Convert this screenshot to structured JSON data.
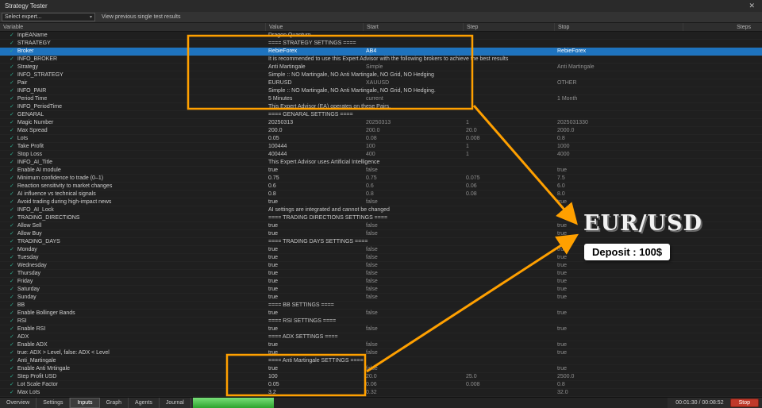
{
  "window": {
    "title": "Strategy Tester",
    "close_icon": "✕"
  },
  "icons": {
    "check": "✓",
    "chevron_down": "▾"
  },
  "toolbar": {
    "expert_select": "Select expert...",
    "hint": "View previous single test results"
  },
  "table": {
    "columns": [
      "Variable",
      "Value",
      "Start",
      "Step",
      "Stop",
      "Steps"
    ],
    "rows": [
      {
        "name": "InpEAName",
        "value": "Dragon Quantum",
        "start": "",
        "step": "",
        "stop": "",
        "steps": ""
      },
      {
        "name": "STRAATEGY",
        "value": "==== STRATEGY SETTINGS ====",
        "start": "",
        "step": "",
        "stop": "",
        "steps": ""
      },
      {
        "name": "Broker",
        "value": "RebieForex",
        "start": "AB4",
        "step": "",
        "stop": "RebieForex",
        "steps": "",
        "selected": true
      },
      {
        "name": "INFO_BROKER",
        "value": "It is recommended to use this Expert Advisor with the following brokers to achieve the best results",
        "start": "",
        "step": "",
        "stop": "",
        "steps": ""
      },
      {
        "name": "Strategy",
        "value": "Anti Martingale",
        "start": "Simple",
        "step": "",
        "stop": "Anti Martingale",
        "steps": ""
      },
      {
        "name": "INFO_STRATEGY",
        "value": "Simple :: NO Martingale, NO Anti Martingale, NO Grid, NO Hedging",
        "start": "",
        "step": "",
        "stop": "",
        "steps": ""
      },
      {
        "name": "Pair",
        "value": "EURUSD",
        "start": "XAUUSD",
        "step": "",
        "stop": "OTHER",
        "steps": ""
      },
      {
        "name": "INFO_PAIR",
        "value": "Simple :: NO Martingale, NO Anti Martingale, NO Grid, NO Hedging.",
        "start": "",
        "step": "",
        "stop": "",
        "steps": ""
      },
      {
        "name": "Period Time",
        "value": "5 Minutes",
        "start": "current",
        "step": "",
        "stop": "1 Month",
        "steps": ""
      },
      {
        "name": "INFO_PeriodTime",
        "value": "This Expert Advisor (EA) operates on these Pairs.",
        "start": "",
        "step": "",
        "stop": "",
        "steps": ""
      },
      {
        "name": "GENARAL",
        "value": "==== GENARAL SETTINGS ====",
        "start": "",
        "step": "",
        "stop": "",
        "steps": ""
      },
      {
        "name": "Magic Number",
        "value": "20250313",
        "start": "20250313",
        "step": "1",
        "stop": "2025031330",
        "steps": ""
      },
      {
        "name": "Max Spread",
        "value": "200.0",
        "start": "200.0",
        "step": "20.0",
        "stop": "2000.0",
        "steps": ""
      },
      {
        "name": "Lots",
        "value": "0.05",
        "start": "0.08",
        "step": "0.008",
        "stop": "0.8",
        "steps": ""
      },
      {
        "name": "Take Profit",
        "value": "100444",
        "start": "100",
        "step": "1",
        "stop": "1000",
        "steps": ""
      },
      {
        "name": "Stop Loss",
        "value": "400444",
        "start": "400",
        "step": "1",
        "stop": "4000",
        "steps": ""
      },
      {
        "name": "INFO_AI_Title",
        "value": "This Expert Advisor uses Artificial Intelligence",
        "start": "",
        "step": "",
        "stop": "",
        "steps": ""
      },
      {
        "name": "Enable AI module",
        "value": "true",
        "start": "false",
        "step": "",
        "stop": "true",
        "steps": ""
      },
      {
        "name": "Minimum confidence to trade (0–1)",
        "value": "0.75",
        "start": "0.75",
        "step": "0.075",
        "stop": "7.5",
        "steps": ""
      },
      {
        "name": "Reaction sensitivity to market changes",
        "value": "0.6",
        "start": "0.6",
        "step": "0.06",
        "stop": "6.0",
        "steps": ""
      },
      {
        "name": "AI influence vs technical signals",
        "value": "0.8",
        "start": "0.8",
        "step": "0.08",
        "stop": "8.0",
        "steps": ""
      },
      {
        "name": "Avoid trading during high-impact news",
        "value": "true",
        "start": "false",
        "step": "",
        "stop": "true",
        "steps": ""
      },
      {
        "name": "INFO_AI_Lock",
        "value": "AI settings are integrated and cannot be changed",
        "start": "",
        "step": "",
        "stop": "",
        "steps": ""
      },
      {
        "name": "TRADING_DIRECTIONS",
        "value": "==== TRADING DIRECTIONS SETTINGS ====",
        "start": "",
        "step": "",
        "stop": "",
        "steps": ""
      },
      {
        "name": "Allow Sell",
        "value": "true",
        "start": "false",
        "step": "",
        "stop": "true",
        "steps": ""
      },
      {
        "name": "Allow Buy",
        "value": "true",
        "start": "false",
        "step": "",
        "stop": "true",
        "steps": ""
      },
      {
        "name": "TRADING_DAYS",
        "value": "==== TRADING DAYS SETTINGS ====",
        "start": "",
        "step": "",
        "stop": "",
        "steps": ""
      },
      {
        "name": "Monday",
        "value": "true",
        "start": "false",
        "step": "",
        "stop": "true",
        "steps": ""
      },
      {
        "name": "Tuesday",
        "value": "true",
        "start": "false",
        "step": "",
        "stop": "true",
        "steps": ""
      },
      {
        "name": "Wednesday",
        "value": "true",
        "start": "false",
        "step": "",
        "stop": "true",
        "steps": ""
      },
      {
        "name": "Thursday",
        "value": "true",
        "start": "false",
        "step": "",
        "stop": "true",
        "steps": ""
      },
      {
        "name": "Friday",
        "value": "true",
        "start": "false",
        "step": "",
        "stop": "true",
        "steps": ""
      },
      {
        "name": "Saturday",
        "value": "true",
        "start": "false",
        "step": "",
        "stop": "true",
        "steps": ""
      },
      {
        "name": "Sunday",
        "value": "true",
        "start": "false",
        "step": "",
        "stop": "true",
        "steps": ""
      },
      {
        "name": "BB",
        "value": "==== BB SETTINGS ====",
        "start": "",
        "step": "",
        "stop": "",
        "steps": ""
      },
      {
        "name": "Enable Bollinger Bands",
        "value": "true",
        "start": "false",
        "step": "",
        "stop": "true",
        "steps": ""
      },
      {
        "name": "RSI",
        "value": "==== RSI SETTINGS ====",
        "start": "",
        "step": "",
        "stop": "",
        "steps": ""
      },
      {
        "name": "Enable RSI",
        "value": "true",
        "start": "false",
        "step": "",
        "stop": "true",
        "steps": ""
      },
      {
        "name": "ADX",
        "value": "==== ADX SETTINGS ====",
        "start": "",
        "step": "",
        "stop": "",
        "steps": ""
      },
      {
        "name": "Enable ADX",
        "value": "true",
        "start": "false",
        "step": "",
        "stop": "true",
        "steps": ""
      },
      {
        "name": "true: ADX > Level, false: ADX < Level",
        "value": "true",
        "start": "false",
        "step": "",
        "stop": "true",
        "steps": ""
      },
      {
        "name": "Anti_Martingale",
        "value": "==== Anti Martingale SETTINGS ====",
        "start": "",
        "step": "",
        "stop": "",
        "steps": ""
      },
      {
        "name": "Enable Anti Mrtingale",
        "value": "true",
        "start": "false",
        "step": "",
        "stop": "true",
        "steps": ""
      },
      {
        "name": "Step Profit USD",
        "value": "100",
        "start": "20.0",
        "step": "25.0",
        "stop": "2500.0",
        "steps": ""
      },
      {
        "name": "Lot Scale Factor",
        "value": "0.05",
        "start": "0.06",
        "step": "0.008",
        "stop": "0.8",
        "steps": ""
      },
      {
        "name": "Max Lots",
        "value": "3.2",
        "start": "0.32",
        "step": "",
        "stop": "32.0",
        "steps": ""
      }
    ]
  },
  "annotations": {
    "pair_label": "EUR/USD",
    "deposit_label": "Deposit : 100$",
    "highlight_color": "#FFA000"
  },
  "bottom": {
    "tabs": [
      "Overview",
      "Settings",
      "Inputs",
      "Graph",
      "Agents",
      "Journal"
    ],
    "active_tab": "Inputs",
    "progress_percent": 17,
    "time": "00:01:30 / 00:08:52",
    "stop_label": "Stop"
  }
}
